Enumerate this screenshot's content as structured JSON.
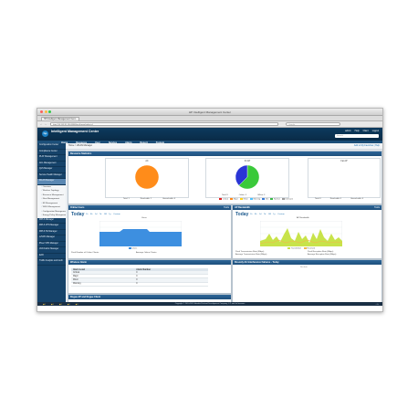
{
  "window": {
    "title": "HP Intelligent Management Center",
    "tab_label": "HP Intelligent Management Cent...",
    "url": "http://16.153.91.160:8080/imc/frame/index.jsf",
    "search_placeholder": "Google"
  },
  "app": {
    "title": "Intelligent Management Center",
    "subtitle": "",
    "header_links": [
      "admin",
      "Help",
      "Client",
      "Logout"
    ],
    "menu": [
      "Home",
      "Resource",
      "User",
      "Service",
      "Alarm",
      "Report",
      "System"
    ],
    "search_placeholder": "Search"
  },
  "sidebar": {
    "items": [
      "Configuration Center",
      "Compliance Center",
      "PLAT Management",
      "ACL Management",
      "QoS Manager",
      "Service Health Manager",
      "WLAN Manager"
    ],
    "sub_items": [
      "Overview",
      "Wireless Topology",
      "Resource Management",
      "Fleet Management",
      "RF Management",
      "WIDS Management",
      "Configuration Management",
      "Energy Policy Management"
    ],
    "items_after": [
      "MPLS Manager",
      "MPLS VPN Manager",
      "MPLS TE Manager",
      "L2VPN Manager",
      "IPsec VPN Manager",
      "VAN Fabric Manager",
      "EAD",
      "Traffic Analysis and Audit"
    ]
  },
  "breadcrumb": {
    "path": "Home > WLAN Manager",
    "right_link": "Add to My Favorites | Help"
  },
  "panels": {
    "statistics": {
      "title": "Resource Statistics",
      "charts": [
        {
          "title": "AC",
          "legend": [
            "Total: 1",
            "Reachable: 1",
            "Unreachable: 0"
          ],
          "slices": [
            {
              "label": "Reachable",
              "value": 1,
              "color": "#ff8c1a"
            }
          ]
        },
        {
          "title": "Fit AP",
          "legend": [
            "Total: 8",
            "Online: 5",
            "Offline: 3"
          ],
          "slices": [
            {
              "label": "Online",
              "value": 5,
              "color": "#3ac93a"
            },
            {
              "label": "Offline",
              "value": 3,
              "color": "#2a35d6"
            }
          ]
        },
        {
          "title": "Fat AP",
          "legend": [
            "Total: 0",
            "Reachable: 0",
            "Unreachable: 0"
          ],
          "slices": []
        }
      ],
      "status_legend": [
        "Critical",
        "Major",
        "Minor",
        "Warning",
        "Info",
        "Normal",
        "Unknown"
      ],
      "status_colors": [
        "#e02020",
        "#ff8a1a",
        "#ffd21a",
        "#4fc3ff",
        "#3a7bd5",
        "#3cb84a",
        "#9b9b9b"
      ]
    },
    "online_users": {
      "title": "Online Users",
      "today": "Today",
      "ranges": [
        "1h",
        "8h",
        "1d",
        "7d",
        "1M",
        "1y",
        "Custom"
      ],
      "chart_title": "Users",
      "legend": "Users",
      "footer_left": "Peak Number of Online Clients:",
      "footer_right": "Average Online Clients:",
      "tool": "Tools"
    },
    "ap_bandwidth": {
      "title": "AP Bandwidth",
      "today": "Today",
      "ranges": [
        "1h",
        "8h",
        "1d",
        "7d",
        "1M",
        "1y",
        "Custom"
      ],
      "chart_title": "AP Bandwidth",
      "legend": [
        "Transmitted",
        "Received"
      ],
      "footer_left": "Peak Transmission Rate (Mbps):",
      "footer_right": "Peak Reception Rate (Mbps):",
      "footer_left2": "Average Transmission Rate (Mbps):",
      "footer_right2": "Average Reception Rate (Mbps):",
      "tool": "Tools"
    },
    "wireless_alarm": {
      "title": "Wireless Alarm",
      "columns": [
        "Alarm Level",
        "Alarm Number"
      ],
      "rows": [
        [
          "Critical",
          "0"
        ],
        [
          "Major",
          "0"
        ],
        [
          "Minor",
          "0"
        ],
        [
          "Warning",
          "0"
        ]
      ]
    },
    "top_interference": {
      "title": "Rosonly Air Interference Failures - Today",
      "nodata": "No data"
    },
    "rogue_ap": {
      "title": "Rogue AP and Rogue Client"
    }
  },
  "footer": {
    "copyright": "Copyright © 2010-2013 Hewlett-Packard Development Company, L.P. and its licensors"
  },
  "colors": {
    "header": "#0c3a5e",
    "menu": "#1c4f79",
    "sidebar": "#16436a",
    "accent": "#1d5a8e",
    "area_users": "#3d8fe0",
    "area_bw": "#c8e34a"
  }
}
